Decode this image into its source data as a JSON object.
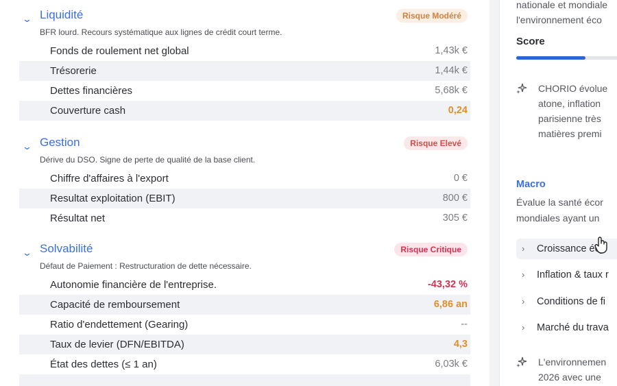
{
  "sections": [
    {
      "title": "Liquidité",
      "badge": "Risque Modéré",
      "description": "BFR lourd. Recours systématique aux lignes de crédit court terme.",
      "rows": [
        {
          "label": "Fonds de roulement net global",
          "value": "1,43k €",
          "tone": "neutral"
        },
        {
          "label": "Trésorerie",
          "value": "1,44k €",
          "tone": "neutral"
        },
        {
          "label": "Dettes financières",
          "value": "5,68k €",
          "tone": "neutral"
        },
        {
          "label": "Couverture cash",
          "value": "0,24",
          "tone": "orange"
        }
      ]
    },
    {
      "title": "Gestion",
      "badge": "Risque Elevé",
      "description": "Dérive du DSO. Signe de perte de qualité de la base client.",
      "rows": [
        {
          "label": "Chiffre d'affaires à l'export",
          "value": "0 €",
          "tone": "neutral"
        },
        {
          "label": "Resultat exploitation (EBIT)",
          "value": "800 €",
          "tone": "neutral"
        },
        {
          "label": "Résultat net",
          "value": "305 €",
          "tone": "neutral"
        }
      ]
    },
    {
      "title": "Solvabilité",
      "badge": "Risque Critique",
      "description": "Défaut de Paiement : Restructuration de dette nécessaire.",
      "rows": [
        {
          "label": "Autonomie financière de l'entreprise.",
          "value": "-43,32 %",
          "tone": "red"
        },
        {
          "label": "Capacité de remboursement",
          "value": "6,86 an",
          "tone": "orange"
        },
        {
          "label": "Ratio d'endettement (Gearing)",
          "value": "--",
          "tone": "neutral"
        },
        {
          "label": "Taux de levier (DFN/EBITDA)",
          "value": "4,3",
          "tone": "orange"
        },
        {
          "label": "État des dettes (≤ 1 an)",
          "value": "6,03k €",
          "tone": "neutral"
        }
      ]
    }
  ],
  "right_panel": {
    "top_text_line1": "nationale et mondiale",
    "top_text_line2": "l'environnement éco",
    "score_label": "Score",
    "score_fraction": 0.63,
    "insight1": [
      "CHORIO évolue",
      "atone, inflation",
      "parisienne très",
      "matières premi"
    ],
    "macro_title": "Macro",
    "macro_desc": [
      "Évalue la santé écor",
      "mondiales ayant un"
    ],
    "accordion": [
      "Croissance écy",
      "Inflation & taux r",
      "Conditions de fi",
      "Marché du trava"
    ],
    "insight2": [
      "L'environnemen",
      "2026 avec une"
    ]
  },
  "icons": {
    "chevron": "chevron-down-icon",
    "spark": "sparkle-icon",
    "arrow": "chevron-right-icon",
    "cursor": "hand-pointer-icon"
  },
  "colors": {
    "accent": "#3a6fe0",
    "orange": "#e0902b",
    "red": "#d4324f",
    "score": "#2f63d8"
  }
}
